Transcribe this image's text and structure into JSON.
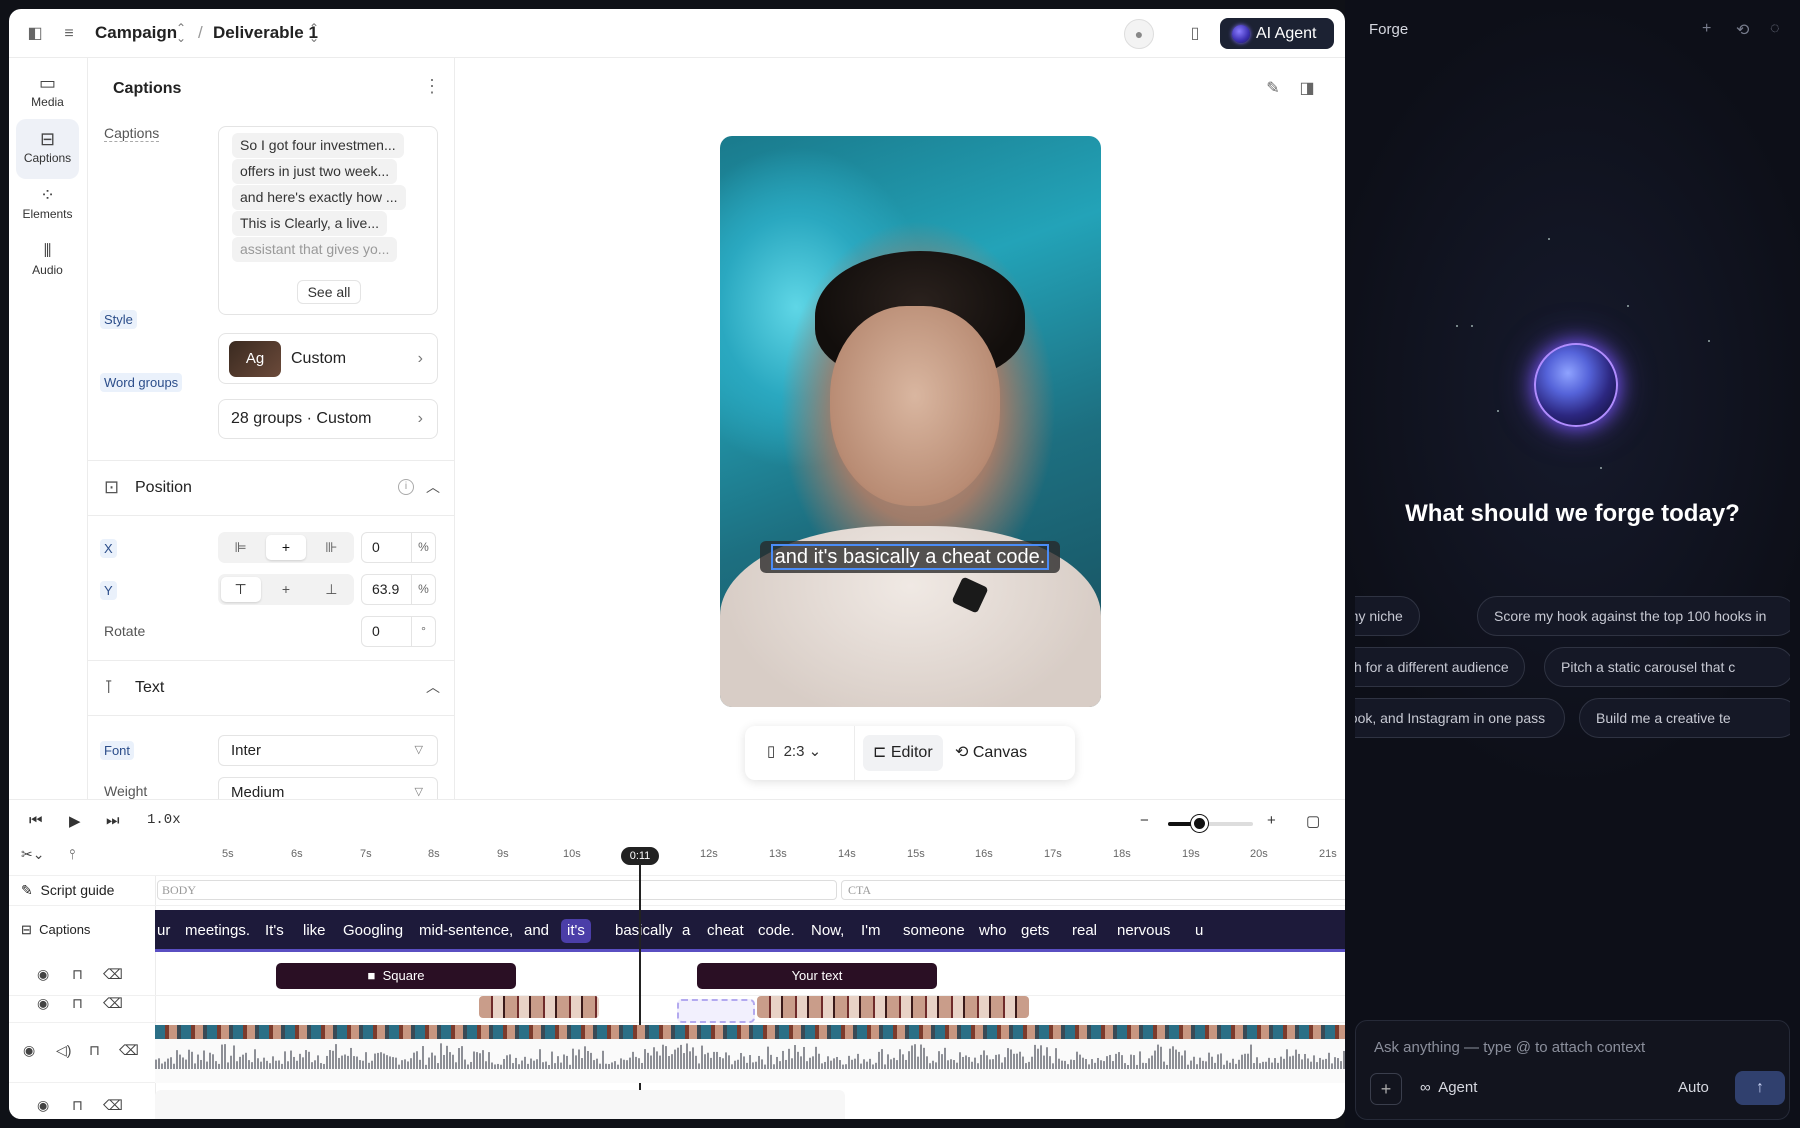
{
  "topbar": {
    "breadcrumb": [
      {
        "label": "Campaign"
      },
      {
        "label": "Deliverable 1"
      }
    ],
    "separator": "/",
    "ai_agent_label": "AI Agent"
  },
  "rail": [
    {
      "label": "Media",
      "icon": "folder-icon"
    },
    {
      "label": "Captions",
      "icon": "captions-icon",
      "active": true
    },
    {
      "label": "Elements",
      "icon": "elements-icon"
    },
    {
      "label": "Audio",
      "icon": "audio-icon"
    }
  ],
  "panel": {
    "title": "Captions",
    "captions_label": "Captions",
    "caption_lines": [
      "So I got four investmen...",
      "offers in just two week...",
      "and here's exactly how ...",
      "This is Clearly, a live...",
      "assistant that gives yo..."
    ],
    "see_all": "See all",
    "style_label": "Style",
    "style_badge": "Ag",
    "style_value": "Custom",
    "word_groups_label": "Word groups",
    "word_groups_value": "28 groups · Custom",
    "position": {
      "title": "Position",
      "x_label": "X",
      "x_value": "0",
      "y_label": "Y",
      "y_value": "63.9",
      "unit_percent": "%",
      "rotate_label": "Rotate",
      "rotate_value": "0",
      "unit_degree": "°"
    },
    "text": {
      "title": "Text",
      "font_label": "Font",
      "font_value": "Inter",
      "weight_label": "Weight",
      "weight_value": "Medium"
    }
  },
  "preview": {
    "subtitle": "and it's basically a cheat code.",
    "ratio": "2:3",
    "editor_label": "Editor",
    "canvas_label": "Canvas"
  },
  "timeline": {
    "speed": "1.0x",
    "ticks": [
      "5s",
      "6s",
      "7s",
      "8s",
      "9s",
      "10s",
      "11s",
      "12s",
      "13s",
      "14s",
      "15s",
      "16s",
      "17s",
      "18s",
      "19s",
      "20s",
      "21s"
    ],
    "playhead_label": "0:11",
    "script_guide_label": "Script guide",
    "captions_label": "Captions",
    "script_sections": [
      "BODY",
      "CTA"
    ],
    "words": [
      "ur",
      "meetings.",
      "It's",
      "like",
      "Googling",
      "mid-sentence,",
      "and",
      "it's",
      "basically",
      "a",
      "cheat",
      "code.",
      "Now,",
      "I'm",
      "someone",
      "who",
      "gets",
      "real",
      "nervous",
      "u"
    ],
    "active_word_index": 7,
    "square_label": "Square",
    "your_text_label": "Your text"
  },
  "forge": {
    "title": "Forge",
    "question": "What should we forge today?",
    "chips": [
      [
        "in my niche",
        "Score my hook against the top 100 hooks in"
      ],
      [
        "ch for a different audience",
        "Pitch a static carousel that c"
      ],
      [
        "book, and Instagram in one pass",
        "Build me a creative te"
      ]
    ],
    "ask_placeholder": "Ask anything — type @ to attach context",
    "agent_label": "Agent",
    "auto_label": "Auto"
  },
  "colors": {
    "accent": "#5a4fc2",
    "caption_track": "#1d1a3a",
    "element_bar": "#2a0f24",
    "sidebar_bg": "#0d0f18"
  }
}
